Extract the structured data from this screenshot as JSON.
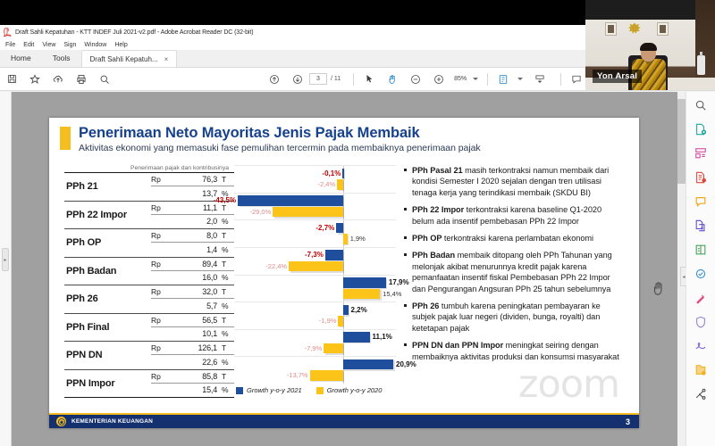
{
  "window": {
    "title": "Draft Sahli Kepatuhan - KTT INDEF Juli 2021-v2.pdf - Adobe Acrobat Reader DC (32-bit)",
    "app_icon": "acrobat-icon",
    "menu": [
      "File",
      "Edit",
      "View",
      "Sign",
      "Window",
      "Help"
    ]
  },
  "tabs": {
    "home": "Home",
    "tools": "Tools",
    "document": "Draft Sahli Kepatuh...",
    "close": "×"
  },
  "toolbar": {
    "save_icon": "save-icon",
    "star_icon": "star-icon",
    "upload_icon": "upload-cloud-icon",
    "print_icon": "print-icon",
    "search_icon": "search-icon",
    "prev_icon": "page-up-icon",
    "next_icon": "page-down-icon",
    "page_current": "3",
    "page_total": "/ 11",
    "select_icon": "select-cursor-icon",
    "hand_icon": "hand-tool-icon",
    "zoom_out_icon": "zoom-out-icon",
    "zoom_in_icon": "zoom-in-icon",
    "zoom_value": "85%",
    "fit_icon": "fit-page-icon",
    "scroll_icon": "scroll-mode-icon",
    "comment_icon": "comment-icon",
    "highlight_icon": "highlight-icon",
    "erase_icon": "erase-highlight-icon",
    "sign_icon": "fill-and-sign-icon"
  },
  "rail": {
    "items": [
      "search-tool-icon",
      "export-pdf-icon",
      "organize-pages-icon",
      "edit-pdf-icon",
      "comment-tool-icon",
      "combine-files-icon",
      "compress-pdf-icon",
      "protect-pdf-icon",
      "stamp-icon",
      "shield-icon",
      "signature-icon",
      "share-file-icon",
      "more-tools-icon"
    ],
    "collapse": "◂"
  },
  "slide": {
    "title": "Penerimaan Neto Mayoritas Jenis Pajak Membaik",
    "subtitle": "Aktivitas ekonomi yang memasuki fase pemulihan tercermin pada membaiknya penerimaan pajak",
    "table_caption": "Penerimaan pajak dan kontribusinya",
    "table_rows": [
      {
        "name": "PPh 21",
        "currency": "Rp",
        "amount": "76,3",
        "unit": "T",
        "share": "13,7",
        "share_unit": "%"
      },
      {
        "name": "PPh 22 Impor",
        "currency": "Rp",
        "amount": "11,1",
        "unit": "T",
        "share": "2,0",
        "share_unit": "%"
      },
      {
        "name": "PPh OP",
        "currency": "Rp",
        "amount": "8,0",
        "unit": "T",
        "share": "1,4",
        "share_unit": "%"
      },
      {
        "name": "PPh Badan",
        "currency": "Rp",
        "amount": "89,4",
        "unit": "T",
        "share": "16,0",
        "share_unit": "%"
      },
      {
        "name": "PPh 26",
        "currency": "Rp",
        "amount": "32,0",
        "unit": "T",
        "share": "5,7",
        "share_unit": "%"
      },
      {
        "name": "PPh Final",
        "currency": "Rp",
        "amount": "56,5",
        "unit": "T",
        "share": "10,1",
        "share_unit": "%"
      },
      {
        "name": "PPN DN",
        "currency": "Rp",
        "amount": "126,1",
        "unit": "T",
        "share": "22,6",
        "share_unit": "%"
      },
      {
        "name": "PPN Impor",
        "currency": "Rp",
        "amount": "85,8",
        "unit": "T",
        "share": "15,4",
        "share_unit": "%"
      }
    ],
    "bullets": [
      {
        "lead": "PPh Pasal 21",
        "rest": " masih terkontraksi namun membaik dari kondisi Semester I 2020 sejalan dengan tren utilisasi tenaga kerja yang terindikasi membaik (SKDU BI)"
      },
      {
        "lead": "PPh 22 Impor",
        "rest": " terkontraksi karena baseline Q1-2020 belum ada insentif pembebasan PPh 22 Impor"
      },
      {
        "lead": "PPh OP",
        "rest": " terkontraksi karena perlambatan ekonomi"
      },
      {
        "lead": "PPh Badan",
        "rest": " membaik ditopang oleh PPh Tahunan yang melonjak akibat menurunnya kredit pajak karena pemanfaatan insentif fiskal Pembebasan PPh 22 Impor dan Pengurangan Angsuran PPh 25 tahun sebelumnya"
      },
      {
        "lead": "PPh 26",
        "rest": " tumbuh karena peningkatan pembayaran ke subjek pajak luar negeri (dividen, bunga, royalti) dan ketetapan pajak"
      },
      {
        "lead": "PPN DN dan PPN Impor",
        "rest": " meningkat seiring dengan membaiknya aktivitas produksi dan konsumsi masyarakat"
      }
    ],
    "footer_org": "KEMENTERIAN KEUANGAN",
    "footer_seal": "ministry-seal-icon",
    "page_number": "3"
  },
  "chart_data": {
    "type": "bar",
    "orientation": "horizontal",
    "title": "",
    "xlabel": "",
    "ylabel": "",
    "grid": true,
    "legend_position": "bottom",
    "xlim": [
      -45,
      22
    ],
    "categories": [
      "PPh 21",
      "PPh 22 Impor",
      "PPh OP",
      "PPh Badan",
      "PPh 26",
      "PPh Final",
      "PPN DN",
      "PPN Impor"
    ],
    "series": [
      {
        "name": "Growth y-o-y 2021",
        "color": "#1f4e9c",
        "values": [
          -0.1,
          -43.5,
          -2.7,
          -7.3,
          17.9,
          2.2,
          11.1,
          20.9
        ],
        "labels": [
          "-0,1%",
          "-43,5%",
          "-2,7%",
          "-7,3%",
          "17,9%",
          "2,2%",
          "11,1%",
          "20,9%"
        ]
      },
      {
        "name": "Growth y-o-y 2020",
        "color": "#fcc319",
        "values": [
          -2.4,
          -29.0,
          1.9,
          -22.4,
          15.4,
          -1.9,
          -7.9,
          -13.7
        ],
        "labels": [
          "-2,4%",
          "-29,0%",
          "1,9%",
          "-22,4%",
          "15,4%",
          "-1,9%",
          "-7,9%",
          "-13,7%"
        ]
      }
    ]
  },
  "video": {
    "participant_name": "Yon Arsal"
  },
  "watermark": {
    "text": "zoom"
  },
  "colors": {
    "brand_blue": "#16418c",
    "accent_yellow": "#f5bd1f",
    "series_2021": "#1f4e9c",
    "series_2020": "#fcc319",
    "negative_label": "#c00000",
    "footer_blue": "#14306e"
  }
}
